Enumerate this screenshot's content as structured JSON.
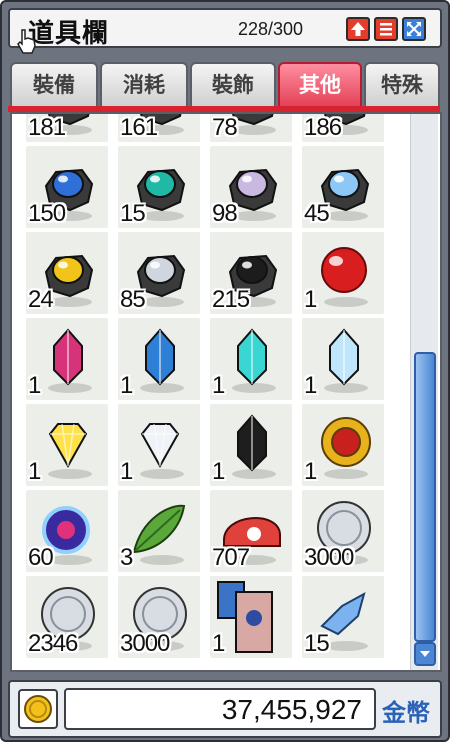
{
  "window": {
    "title": "道具欄",
    "capacity": "228/300"
  },
  "tabs": [
    {
      "label": "裝備",
      "active": false
    },
    {
      "label": "消耗",
      "active": false
    },
    {
      "label": "裝飾",
      "active": false
    },
    {
      "label": "其他",
      "active": true
    },
    {
      "label": "特殊",
      "active": false
    }
  ],
  "items": [
    {
      "icon": "red-pink-item-icon",
      "qty": "181"
    },
    {
      "icon": "red-pink-item-icon",
      "qty": "161"
    },
    {
      "icon": "dark-ore-item-icon",
      "qty": "78"
    },
    {
      "icon": "dark-ore-item-icon",
      "qty": "186"
    },
    {
      "icon": "blue-ore-icon",
      "qty": "150",
      "color": "#2f6fd8"
    },
    {
      "icon": "teal-ore-icon",
      "qty": "15",
      "color": "#1fb9a6"
    },
    {
      "icon": "rainbow-ore-icon",
      "qty": "98",
      "color": "#c9b8e0"
    },
    {
      "icon": "lightblue-ore-icon",
      "qty": "45",
      "color": "#8cc7f5"
    },
    {
      "icon": "gold-ore-icon",
      "qty": "24",
      "color": "#f0c419"
    },
    {
      "icon": "silver-ore-icon",
      "qty": "85",
      "color": "#cfd6e0"
    },
    {
      "icon": "black-ore-icon",
      "qty": "215",
      "color": "#1c1c1c"
    },
    {
      "icon": "red-sphere-icon",
      "qty": "1",
      "color": "#d81e1e"
    },
    {
      "icon": "pink-crystal-icon",
      "qty": "1",
      "color": "#d6337a"
    },
    {
      "icon": "blue-crystal-icon",
      "qty": "1",
      "color": "#2e7fd6"
    },
    {
      "icon": "aqua-crystal-icon",
      "qty": "1",
      "color": "#3ad6d2"
    },
    {
      "icon": "ice-crystal-icon",
      "qty": "1",
      "color": "#bfe6fb"
    },
    {
      "icon": "yellow-gem-icon",
      "qty": "1",
      "color": "#ffe14a"
    },
    {
      "icon": "diamond-icon",
      "qty": "1",
      "color": "#eef3f8"
    },
    {
      "icon": "black-crystal-icon",
      "qty": "1",
      "color": "#1e1e1e"
    },
    {
      "icon": "gold-medal-icon",
      "qty": "1",
      "color": "#e8b21c"
    },
    {
      "icon": "dark-orb-icon",
      "qty": "60",
      "color": "#3a2aa0"
    },
    {
      "icon": "green-leaf-icon",
      "qty": "3",
      "color": "#5aa83a"
    },
    {
      "icon": "red-mushroom-cap-icon",
      "qty": "707",
      "color": "#e0413a"
    },
    {
      "icon": "silver-coin-icon",
      "qty": "3000",
      "color": "#d8dde3"
    },
    {
      "icon": "silver-coin-icon",
      "qty": "2346",
      "color": "#d8dde3"
    },
    {
      "icon": "silver-coin-icon",
      "qty": "3000",
      "color": "#d8dde3"
    },
    {
      "icon": "cards-icon",
      "qty": "1",
      "color": "#3b73c6"
    },
    {
      "icon": "blue-shard-icon",
      "qty": "15",
      "color": "#7ab3f0"
    }
  ],
  "footer": {
    "gold_amount": "37,455,927",
    "gold_label": "金幣"
  }
}
